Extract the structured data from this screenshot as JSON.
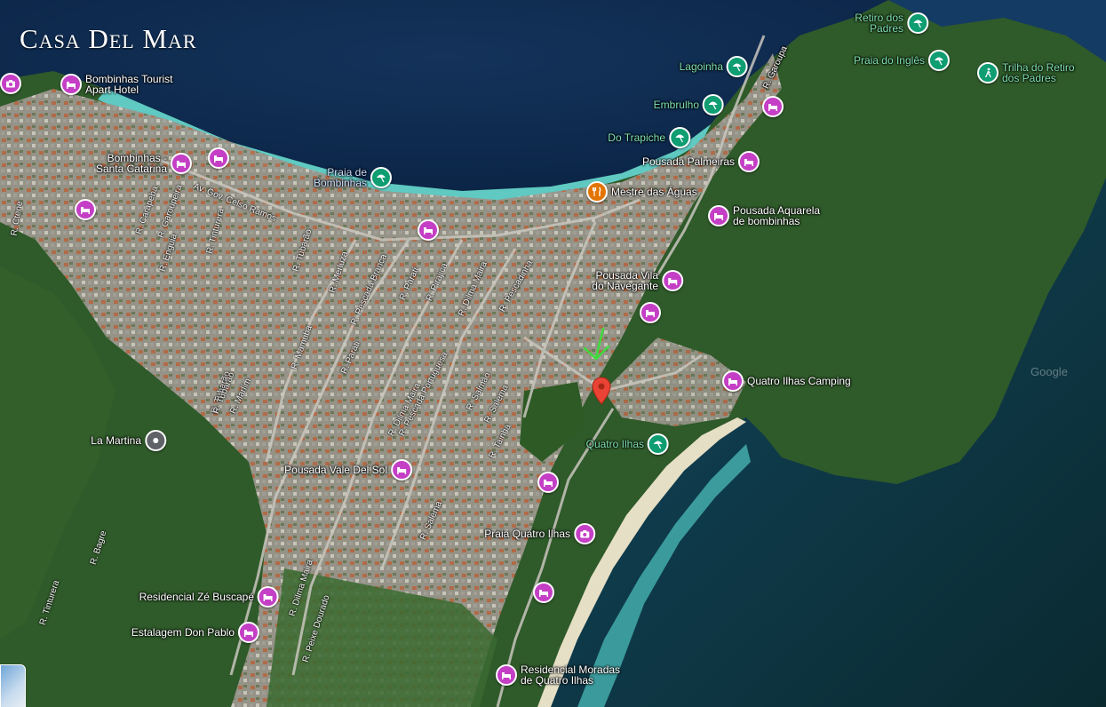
{
  "title": "Casa Del Mar",
  "watermark": "Google",
  "colors": {
    "lodging": "#c43fc5",
    "beach": "#0f9d72",
    "restaurant": "#e37400",
    "camera": "#c43fc5",
    "generic": "#5f6368",
    "marker": "#ea4335",
    "arrow": "#3ddc3d"
  },
  "pois": [
    {
      "name": "bombinhas-tourist-poi",
      "label": "Bombinhas Tourist\nApart Hotel",
      "icon": "bed-icon",
      "kind": "lodging"
    },
    {
      "name": "bombinhas-sc-poi",
      "label": "Bombinhas -\nSanta Catarina",
      "icon": "bed-icon",
      "kind": "lodging"
    },
    {
      "name": "praia-de-bombinhas-poi",
      "label": "Praia de\nBombinhas",
      "icon": "beach-umbrella-icon",
      "kind": "beach"
    },
    {
      "name": "mestre-das-aguas-poi",
      "label": "Mestre das Águas",
      "icon": "fork-knife-icon",
      "kind": "restaurant"
    },
    {
      "name": "pousada-palmeiras-poi",
      "label": "Pousada Palmeiras",
      "icon": "bed-icon",
      "kind": "lodging"
    },
    {
      "name": "pousada-aquarela-poi",
      "label": "Pousada Aquarela\nde bombinhas",
      "icon": "bed-icon",
      "kind": "lodging"
    },
    {
      "name": "pousada-vila-navegante-poi",
      "label": "Pousada Vila\ndo Navegante",
      "icon": "bed-icon",
      "kind": "lodging"
    },
    {
      "name": "quatro-ilhas-camping-poi",
      "label": "Quatro Ilhas Camping",
      "icon": "bed-icon",
      "kind": "lodging"
    },
    {
      "name": "quatro-ilhas-poi",
      "label": "Quatro Ilhas",
      "icon": "beach-umbrella-icon",
      "kind": "beach"
    },
    {
      "name": "la-martina-poi",
      "label": "La Martina",
      "icon": "circle-dot-icon",
      "kind": "generic"
    },
    {
      "name": "pousada-vale-del-sol-poi",
      "label": "Pousada Vale Del Sol",
      "icon": "bed-icon",
      "kind": "lodging"
    },
    {
      "name": "praia-quatro-ilhas-poi",
      "label": "Praia Quatro Ilhas",
      "icon": "camera-icon",
      "kind": "camera"
    },
    {
      "name": "residencial-ze-buscape-poi",
      "label": "Residencial Zé Buscapé",
      "icon": "bed-icon",
      "kind": "lodging"
    },
    {
      "name": "estalagem-don-pablo-poi",
      "label": "Estalagem Don Pablo",
      "icon": "bed-icon",
      "kind": "lodging"
    },
    {
      "name": "residencial-moradas-poi",
      "label": "Residencial Moradas\nde Quatro Ilhas",
      "icon": "bed-icon",
      "kind": "lodging"
    },
    {
      "name": "lagoinha-poi",
      "label": "Lagoinha",
      "icon": "beach-umbrella-icon",
      "kind": "beach"
    },
    {
      "name": "embrulho-poi",
      "label": "Embrulho",
      "icon": "beach-umbrella-icon",
      "kind": "beach"
    },
    {
      "name": "do-trapiche-poi",
      "label": "Do Trapiche",
      "icon": "beach-umbrella-icon",
      "kind": "beach"
    },
    {
      "name": "retiro-dos-padres-poi",
      "label": "Retiro dos\nPadres",
      "icon": "beach-umbrella-icon",
      "kind": "beach"
    },
    {
      "name": "praia-do-ingles-poi",
      "label": "Praia do Inglês",
      "icon": "beach-umbrella-icon",
      "kind": "beach"
    },
    {
      "name": "trilha-retiro-poi",
      "label": "Trilha do Retiro\ndos Padres",
      "icon": "hiker-icon",
      "kind": "beach"
    },
    {
      "name": "unlabeled-lodging-poi",
      "label": "",
      "icon": "bed-icon",
      "kind": "lodging"
    },
    {
      "name": "unlabeled-camera-poi",
      "label": "",
      "icon": "camera-icon",
      "kind": "camera"
    }
  ],
  "streets": [
    "Av. Gov. Celso Ramos",
    "R. Carapeba",
    "R. Garoupeira",
    "R. Tinturera",
    "R. Enguia",
    "R. Ctene",
    "R. Tubarão",
    "R. Merluza",
    "R. Pescada Branca",
    "R. Parati",
    "R. Pirajica",
    "R. Dilma Maira",
    "R. Pescadinha",
    "R. Mamuba",
    "R. Pescada Portuguesa",
    "R. Salmão",
    "R. Salema",
    "R. Tainha",
    "R. Marlim",
    "R. Bagre",
    "R. Peixe Dourado",
    "R. Garoupa",
    "R. Parati",
    "R. Dilma Maira",
    "R. Tubarão",
    "R. Tubarão",
    "R. Tinturera",
    "R. Salema",
    "R. Dilma Maira",
    "R. Garoupa"
  ]
}
